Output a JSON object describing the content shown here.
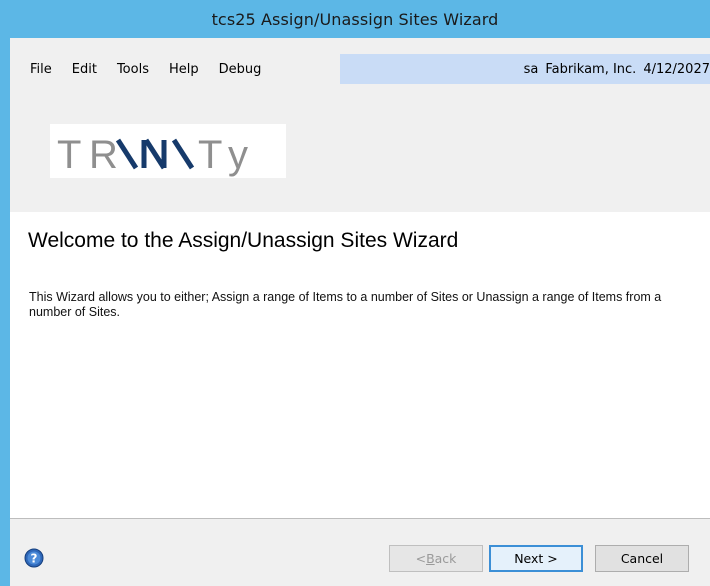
{
  "window": {
    "title": "tcs25 Assign/Unassign Sites Wizard"
  },
  "menu": {
    "items": [
      "File",
      "Edit",
      "Tools",
      "Help",
      "Debug"
    ],
    "user": "sa",
    "company": "Fabrikam, Inc.",
    "date": "4/12/2027"
  },
  "logo": {
    "text": "TRINITY"
  },
  "content": {
    "heading": "Welcome to the Assign/Unassign Sites Wizard",
    "description": "This Wizard allows you to either; Assign a range of Items to a number of Sites or Unassign a range of Items from a number of Sites."
  },
  "buttons": {
    "back_prefix": "< ",
    "back_mnemonic": "B",
    "back_rest": "ack",
    "next": "Next >",
    "cancel": "Cancel"
  },
  "icons": {
    "help": "help-icon"
  },
  "colors": {
    "titlebar": "#5cb7e6",
    "menu_status": "#c9dcf6",
    "logo_navy": "#163a6b",
    "logo_grey": "#8f8f8f"
  }
}
